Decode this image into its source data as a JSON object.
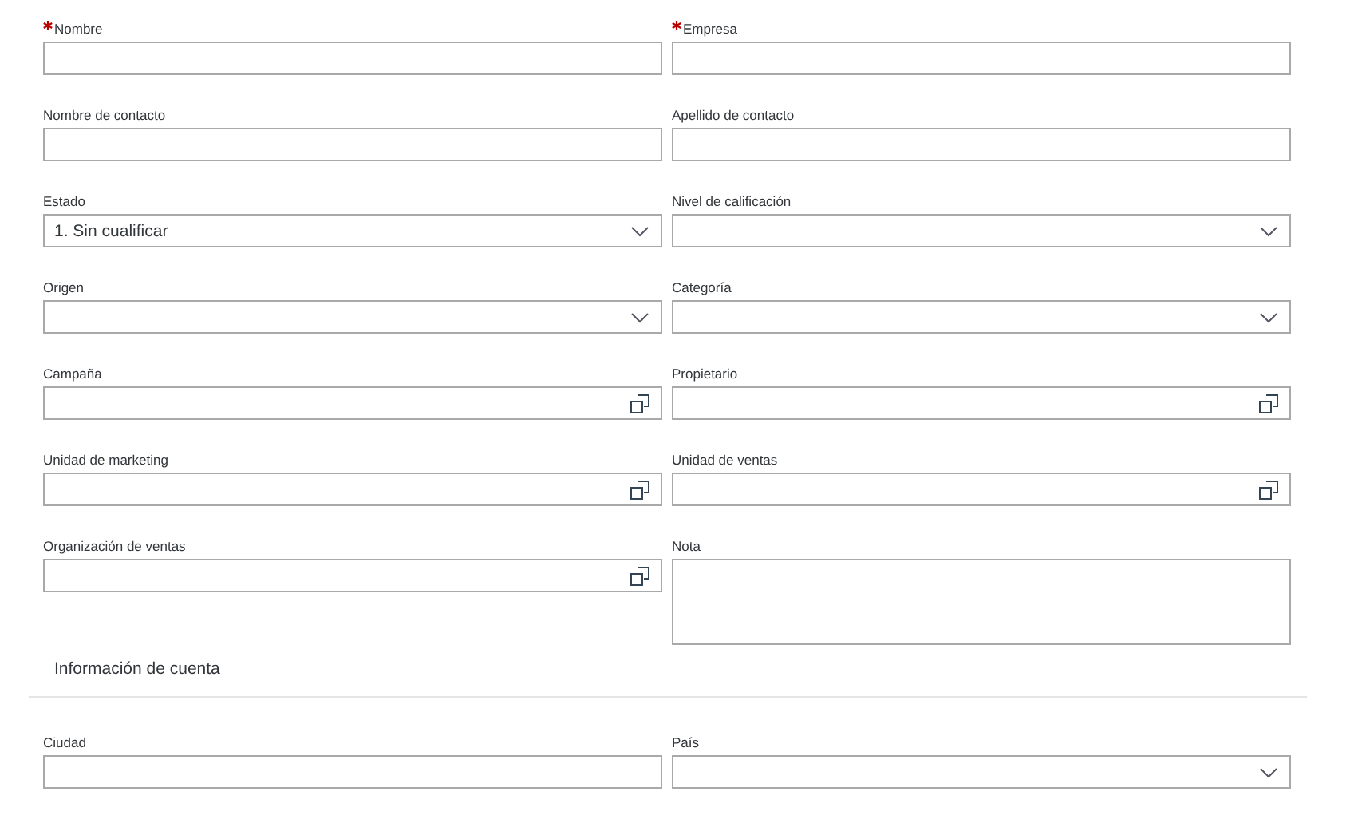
{
  "fields": [
    {
      "label": "Nombre",
      "required": true,
      "kind": "text"
    },
    {
      "label": "Empresa",
      "required": true,
      "kind": "text"
    },
    {
      "label": "Nombre de contacto",
      "required": false,
      "kind": "text"
    },
    {
      "label": "Apellido de contacto",
      "required": false,
      "kind": "text"
    },
    {
      "label": "Estado",
      "required": false,
      "kind": "select",
      "value": "1. Sin cualificar"
    },
    {
      "label": "Nivel de calificación",
      "required": false,
      "kind": "select"
    },
    {
      "label": "Origen",
      "required": false,
      "kind": "select"
    },
    {
      "label": "Categoría",
      "required": false,
      "kind": "select"
    },
    {
      "label": "Campaña",
      "required": false,
      "kind": "lookup"
    },
    {
      "label": "Propietario",
      "required": false,
      "kind": "lookup"
    },
    {
      "label": "Unidad de marketing",
      "required": false,
      "kind": "lookup"
    },
    {
      "label": "Unidad de ventas",
      "required": false,
      "kind": "lookup"
    },
    {
      "label": "Organización de ventas",
      "required": false,
      "kind": "lookup"
    },
    {
      "label": "Nota",
      "required": false,
      "kind": "textarea"
    }
  ],
  "section": {
    "title": "Información de cuenta"
  },
  "account_fields": [
    {
      "label": "Ciudad",
      "required": false,
      "kind": "text"
    },
    {
      "label": "País",
      "required": false,
      "kind": "select"
    }
  ]
}
